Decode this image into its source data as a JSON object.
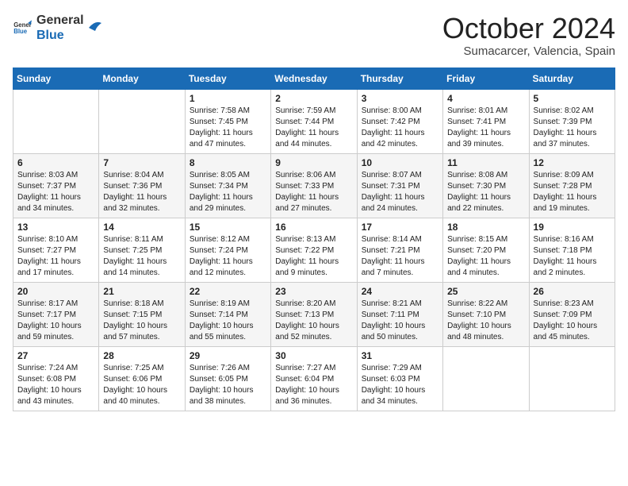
{
  "logo": {
    "text_general": "General",
    "text_blue": "Blue"
  },
  "header": {
    "month": "October 2024",
    "location": "Sumacarcer, Valencia, Spain"
  },
  "weekdays": [
    "Sunday",
    "Monday",
    "Tuesday",
    "Wednesday",
    "Thursday",
    "Friday",
    "Saturday"
  ],
  "weeks": [
    [
      {
        "day": "",
        "info": ""
      },
      {
        "day": "",
        "info": ""
      },
      {
        "day": "1",
        "info": "Sunrise: 7:58 AM\nSunset: 7:45 PM\nDaylight: 11 hours and 47 minutes."
      },
      {
        "day": "2",
        "info": "Sunrise: 7:59 AM\nSunset: 7:44 PM\nDaylight: 11 hours and 44 minutes."
      },
      {
        "day": "3",
        "info": "Sunrise: 8:00 AM\nSunset: 7:42 PM\nDaylight: 11 hours and 42 minutes."
      },
      {
        "day": "4",
        "info": "Sunrise: 8:01 AM\nSunset: 7:41 PM\nDaylight: 11 hours and 39 minutes."
      },
      {
        "day": "5",
        "info": "Sunrise: 8:02 AM\nSunset: 7:39 PM\nDaylight: 11 hours and 37 minutes."
      }
    ],
    [
      {
        "day": "6",
        "info": "Sunrise: 8:03 AM\nSunset: 7:37 PM\nDaylight: 11 hours and 34 minutes."
      },
      {
        "day": "7",
        "info": "Sunrise: 8:04 AM\nSunset: 7:36 PM\nDaylight: 11 hours and 32 minutes."
      },
      {
        "day": "8",
        "info": "Sunrise: 8:05 AM\nSunset: 7:34 PM\nDaylight: 11 hours and 29 minutes."
      },
      {
        "day": "9",
        "info": "Sunrise: 8:06 AM\nSunset: 7:33 PM\nDaylight: 11 hours and 27 minutes."
      },
      {
        "day": "10",
        "info": "Sunrise: 8:07 AM\nSunset: 7:31 PM\nDaylight: 11 hours and 24 minutes."
      },
      {
        "day": "11",
        "info": "Sunrise: 8:08 AM\nSunset: 7:30 PM\nDaylight: 11 hours and 22 minutes."
      },
      {
        "day": "12",
        "info": "Sunrise: 8:09 AM\nSunset: 7:28 PM\nDaylight: 11 hours and 19 minutes."
      }
    ],
    [
      {
        "day": "13",
        "info": "Sunrise: 8:10 AM\nSunset: 7:27 PM\nDaylight: 11 hours and 17 minutes."
      },
      {
        "day": "14",
        "info": "Sunrise: 8:11 AM\nSunset: 7:25 PM\nDaylight: 11 hours and 14 minutes."
      },
      {
        "day": "15",
        "info": "Sunrise: 8:12 AM\nSunset: 7:24 PM\nDaylight: 11 hours and 12 minutes."
      },
      {
        "day": "16",
        "info": "Sunrise: 8:13 AM\nSunset: 7:22 PM\nDaylight: 11 hours and 9 minutes."
      },
      {
        "day": "17",
        "info": "Sunrise: 8:14 AM\nSunset: 7:21 PM\nDaylight: 11 hours and 7 minutes."
      },
      {
        "day": "18",
        "info": "Sunrise: 8:15 AM\nSunset: 7:20 PM\nDaylight: 11 hours and 4 minutes."
      },
      {
        "day": "19",
        "info": "Sunrise: 8:16 AM\nSunset: 7:18 PM\nDaylight: 11 hours and 2 minutes."
      }
    ],
    [
      {
        "day": "20",
        "info": "Sunrise: 8:17 AM\nSunset: 7:17 PM\nDaylight: 10 hours and 59 minutes."
      },
      {
        "day": "21",
        "info": "Sunrise: 8:18 AM\nSunset: 7:15 PM\nDaylight: 10 hours and 57 minutes."
      },
      {
        "day": "22",
        "info": "Sunrise: 8:19 AM\nSunset: 7:14 PM\nDaylight: 10 hours and 55 minutes."
      },
      {
        "day": "23",
        "info": "Sunrise: 8:20 AM\nSunset: 7:13 PM\nDaylight: 10 hours and 52 minutes."
      },
      {
        "day": "24",
        "info": "Sunrise: 8:21 AM\nSunset: 7:11 PM\nDaylight: 10 hours and 50 minutes."
      },
      {
        "day": "25",
        "info": "Sunrise: 8:22 AM\nSunset: 7:10 PM\nDaylight: 10 hours and 48 minutes."
      },
      {
        "day": "26",
        "info": "Sunrise: 8:23 AM\nSunset: 7:09 PM\nDaylight: 10 hours and 45 minutes."
      }
    ],
    [
      {
        "day": "27",
        "info": "Sunrise: 7:24 AM\nSunset: 6:08 PM\nDaylight: 10 hours and 43 minutes."
      },
      {
        "day": "28",
        "info": "Sunrise: 7:25 AM\nSunset: 6:06 PM\nDaylight: 10 hours and 40 minutes."
      },
      {
        "day": "29",
        "info": "Sunrise: 7:26 AM\nSunset: 6:05 PM\nDaylight: 10 hours and 38 minutes."
      },
      {
        "day": "30",
        "info": "Sunrise: 7:27 AM\nSunset: 6:04 PM\nDaylight: 10 hours and 36 minutes."
      },
      {
        "day": "31",
        "info": "Sunrise: 7:29 AM\nSunset: 6:03 PM\nDaylight: 10 hours and 34 minutes."
      },
      {
        "day": "",
        "info": ""
      },
      {
        "day": "",
        "info": ""
      }
    ]
  ]
}
